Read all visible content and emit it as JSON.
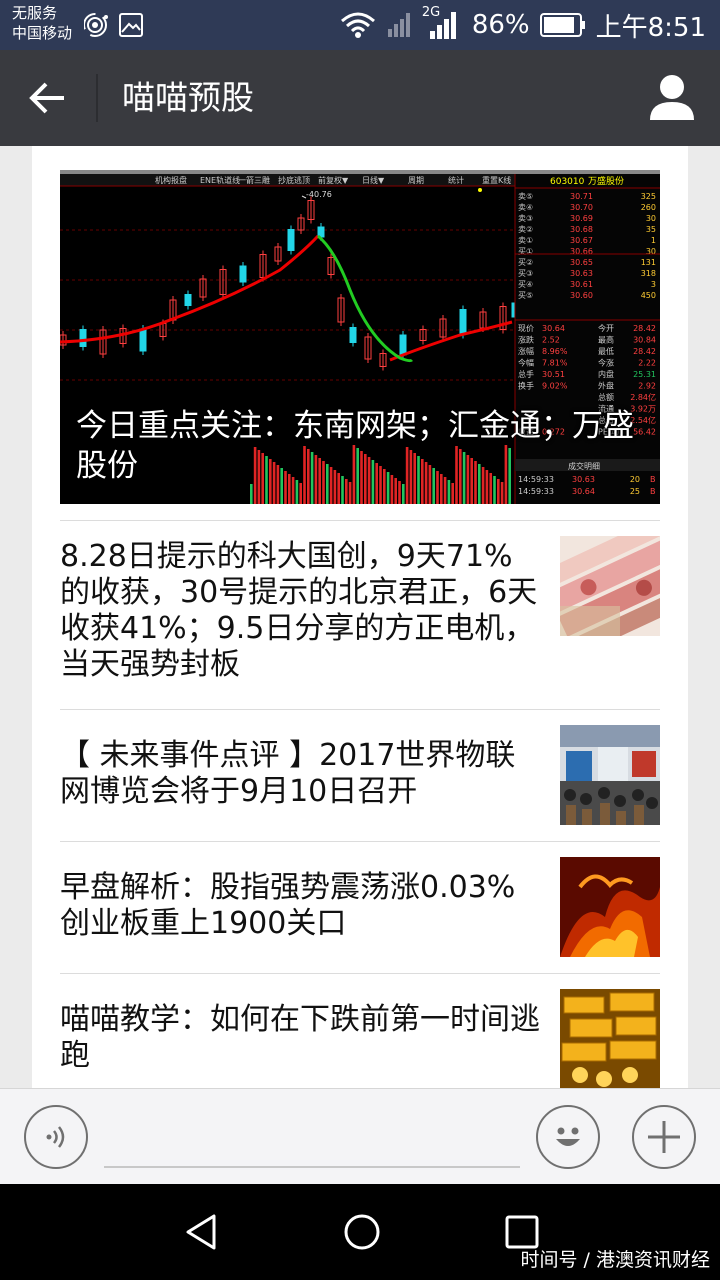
{
  "status_bar": {
    "carrier_line1": "无服务",
    "carrier_line2": "中国移动",
    "network_type": "2G",
    "battery": "86%",
    "time": "上午8:51",
    "icons": [
      "hotspot-icon",
      "image-icon",
      "wifi-icon",
      "signal-icon",
      "battery-icon"
    ]
  },
  "app_bar": {
    "title": "喵喵预股",
    "back_icon": "back-arrow-icon",
    "profile_icon": "person-icon",
    "background": "#393a3f"
  },
  "hero": {
    "caption": "今日重点关注：东南网架；汇金通；万盛股份",
    "chart_labels": {
      "toolbar": [
        "机构报盘",
        "ENE轨道线",
        "一箭三雕",
        "抄底逃顶",
        "前复权▼",
        "日线▼",
        "周期",
        "统计",
        "重置K线"
      ],
      "peak_price": "40.76",
      "stock_code": "603010",
      "stock_name": "万盛股份",
      "order_book": [
        [
          "卖⑤",
          "30.71",
          "325"
        ],
        [
          "卖④",
          "30.70",
          "260"
        ],
        [
          "卖③",
          "30.69",
          "30"
        ],
        [
          "卖②",
          "30.68",
          "35"
        ],
        [
          "卖①",
          "30.67",
          "1"
        ],
        [
          "买①",
          "30.66",
          "30"
        ],
        [
          "买②",
          "30.65",
          "131"
        ],
        [
          "买③",
          "30.63",
          "318"
        ],
        [
          "买④",
          "30.61",
          "3"
        ],
        [
          "买⑤",
          "30.60",
          "450"
        ]
      ],
      "quote_rows": [
        [
          "现价",
          "30.64",
          "今开",
          "28.42"
        ],
        [
          "涨跌",
          "2.52",
          "最高",
          "30.84"
        ],
        [
          "涨幅",
          "8.96%",
          "最低",
          "28.42"
        ],
        [
          "今幅",
          "7.81%",
          "今涨",
          "2.22"
        ],
        [
          "总手",
          "30.51",
          "内盘",
          "25.31"
        ],
        [
          "换手",
          "9.02%",
          "外盘",
          "2.92"
        ],
        [
          "",
          "",
          "总额",
          "2.84亿"
        ],
        [
          "",
          "",
          "流通",
          "3.92万"
        ],
        [
          "",
          "",
          "总值",
          "2.54亿"
        ],
        [
          "收益",
          "0.272",
          "PE(动)",
          "56.42"
        ]
      ],
      "trade_header": "成交明细",
      "trades": [
        [
          "14:59:33",
          "30.63",
          "20",
          "B"
        ],
        [
          "14:59:33",
          "30.64",
          "25",
          "B"
        ]
      ]
    }
  },
  "articles": [
    {
      "title": "8.28日提示的科大国创，9天71%的收获，30号提示的北京君正，6天收获41%；9.5日分享的方正电机，当天强势封板",
      "thumb": "money-image"
    },
    {
      "title": "【 未来事件点评 】2017世界物联网博览会将于9月10日召开",
      "thumb": "expo-image"
    },
    {
      "title": "早盘解析：股指强势震荡涨0.03% 创业板重上1900关口",
      "thumb": "fire-bull-image"
    },
    {
      "title": "喵喵教学：如何在下跌前第一时间逃跑",
      "thumb": "gold-bars-image"
    }
  ],
  "bottom_bar": {
    "voice_icon": "voice-icon",
    "emoji_icon": "emoji-icon",
    "plus_icon": "plus-icon"
  },
  "nav_bar": {
    "icons": [
      "nav-back-icon",
      "nav-home-icon",
      "nav-recents-icon"
    ]
  },
  "watermark": "时间号 / 港澳资讯财经"
}
